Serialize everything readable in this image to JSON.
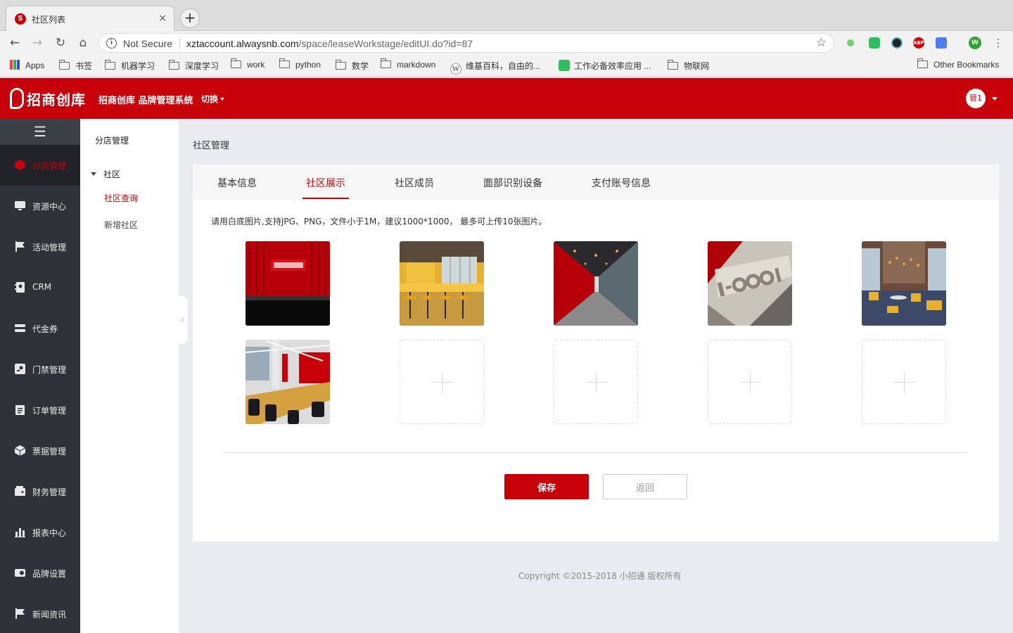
{
  "browser": {
    "tab_title": "社区列表",
    "tab_close": "×",
    "new_tab": "+",
    "security": "Not Secure",
    "url_host": "xztaccount.alwaysnb.com",
    "url_path": "/space/leaseWorkstage/editUI.do?id=87",
    "bookmarks": [
      "Apps",
      "书签",
      "机器学习",
      "深度学习",
      "work",
      "python",
      "数学",
      "markdown",
      "维基百科，自由的...",
      "工作必备效率应用 ...",
      "物联网"
    ],
    "other_bookmarks": "Other Bookmarks",
    "profile_initial": "W",
    "abp": "ABP"
  },
  "header": {
    "logo_text": "招商创库",
    "system_title": "招商创库 品牌管理系统",
    "switch_label": "切换",
    "avatar_text": "管1",
    "brand_color": "#c8000a"
  },
  "sidebar": {
    "items": [
      {
        "label": "分店管理",
        "icon": "hexagon-icon"
      },
      {
        "label": "资源中心",
        "icon": "monitor-icon"
      },
      {
        "label": "活动管理",
        "icon": "flag-icon"
      },
      {
        "label": "CRM",
        "icon": "contact-book-icon"
      },
      {
        "label": "代金券",
        "icon": "ticket-icon"
      },
      {
        "label": "门禁管理",
        "icon": "key-icon"
      },
      {
        "label": "订单管理",
        "icon": "clipboard-icon"
      },
      {
        "label": "票据管理",
        "icon": "box-icon"
      },
      {
        "label": "财务管理",
        "icon": "wallet-icon"
      },
      {
        "label": "报表中心",
        "icon": "bar-chart-icon"
      },
      {
        "label": "品牌设置",
        "icon": "toggle-icon"
      },
      {
        "label": "新闻资讯",
        "icon": "flag-icon"
      }
    ]
  },
  "subnav": {
    "heading": "分店管理",
    "group": "社区",
    "links": [
      "社区查询",
      "新增社区"
    ]
  },
  "main": {
    "breadcrumb": "社区管理",
    "tabs": [
      "基本信息",
      "社区展示",
      "社区成员",
      "面部识别设备",
      "支付账号信息"
    ],
    "active_tab": "社区展示",
    "hint": "请用白底图片,支持JPG、PNG，文件小于1M，建议1000*1000， 最多可上传10张图片。",
    "photos": [
      {
        "desc": "red-lobby-logo-wall"
      },
      {
        "desc": "yellow-cafe-bar"
      },
      {
        "desc": "red-corridor"
      },
      {
        "desc": "i-cool-logo-wall"
      },
      {
        "desc": "lounge-with-chairs"
      },
      {
        "desc": "open-office-desks"
      }
    ],
    "upload_slots": 4,
    "save_label": "保存",
    "back_label": "返回"
  },
  "footer": {
    "copyright": "Copyright ©2015-2018 小招通 版权所有"
  }
}
